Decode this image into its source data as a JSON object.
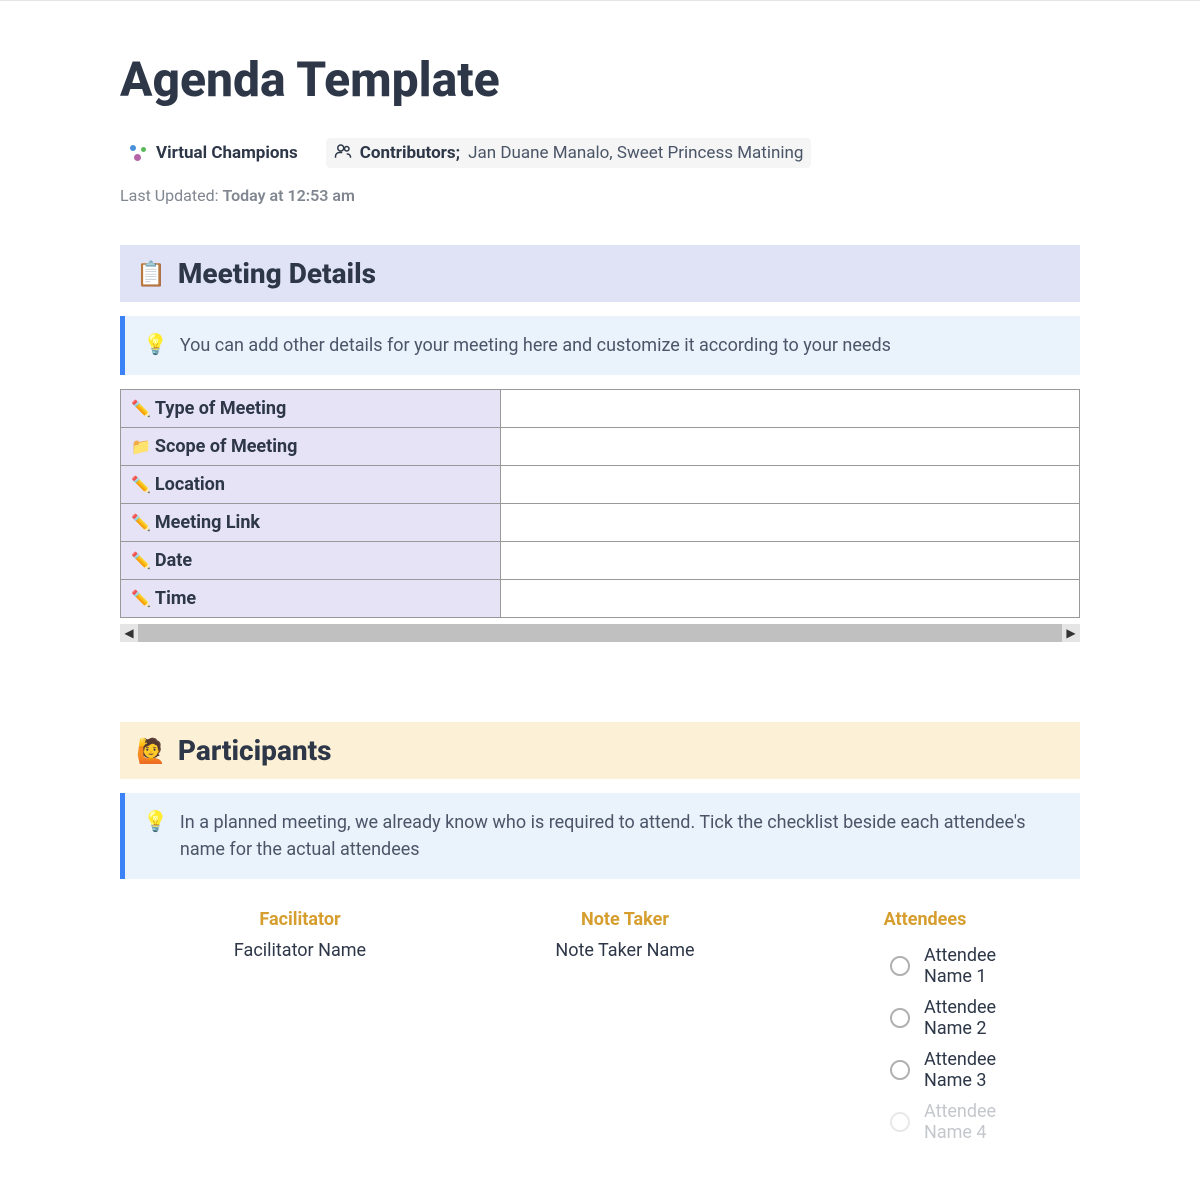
{
  "page_title": "Agenda Template",
  "team": {
    "name": "Virtual Champions"
  },
  "contributors": {
    "label": "Contributors;",
    "names": "Jan Duane Manalo, Sweet Princess Matining"
  },
  "last_updated": {
    "label": "Last Updated:",
    "value": "Today at 12:53 am"
  },
  "meeting_details": {
    "icon": "📋",
    "title": "Meeting Details",
    "tip": "You can add other details for your meeting here and customize it according to your needs",
    "rows": [
      {
        "icon": "✏️",
        "label": "Type of Meeting",
        "value": ""
      },
      {
        "icon": "📁",
        "label": "Scope of Meeting",
        "value": ""
      },
      {
        "icon": "✏️",
        "label": "Location",
        "value": ""
      },
      {
        "icon": "✏️",
        "label": "Meeting Link",
        "value": ""
      },
      {
        "icon": "✏️",
        "label": "Date",
        "value": ""
      },
      {
        "icon": "✏️",
        "label": "Time",
        "value": ""
      }
    ]
  },
  "participants": {
    "icon": "🙋",
    "title": "Participants",
    "tip": "In a planned meeting, we already know who is required to attend. Tick the checklist beside each attendee's name for the actual attendees",
    "facilitator_heading": "Facilitator",
    "facilitator_value": "Facilitator Name",
    "note_taker_heading": "Note Taker",
    "note_taker_value": "Note Taker Name",
    "attendees_heading": "Attendees",
    "attendees": [
      {
        "name": "Attendee Name 1",
        "checked": false,
        "faded": false
      },
      {
        "name": "Attendee Name 2",
        "checked": false,
        "faded": false
      },
      {
        "name": "Attendee Name 3",
        "checked": false,
        "faded": false
      },
      {
        "name": "Attendee Name 4",
        "checked": false,
        "faded": true
      }
    ]
  }
}
